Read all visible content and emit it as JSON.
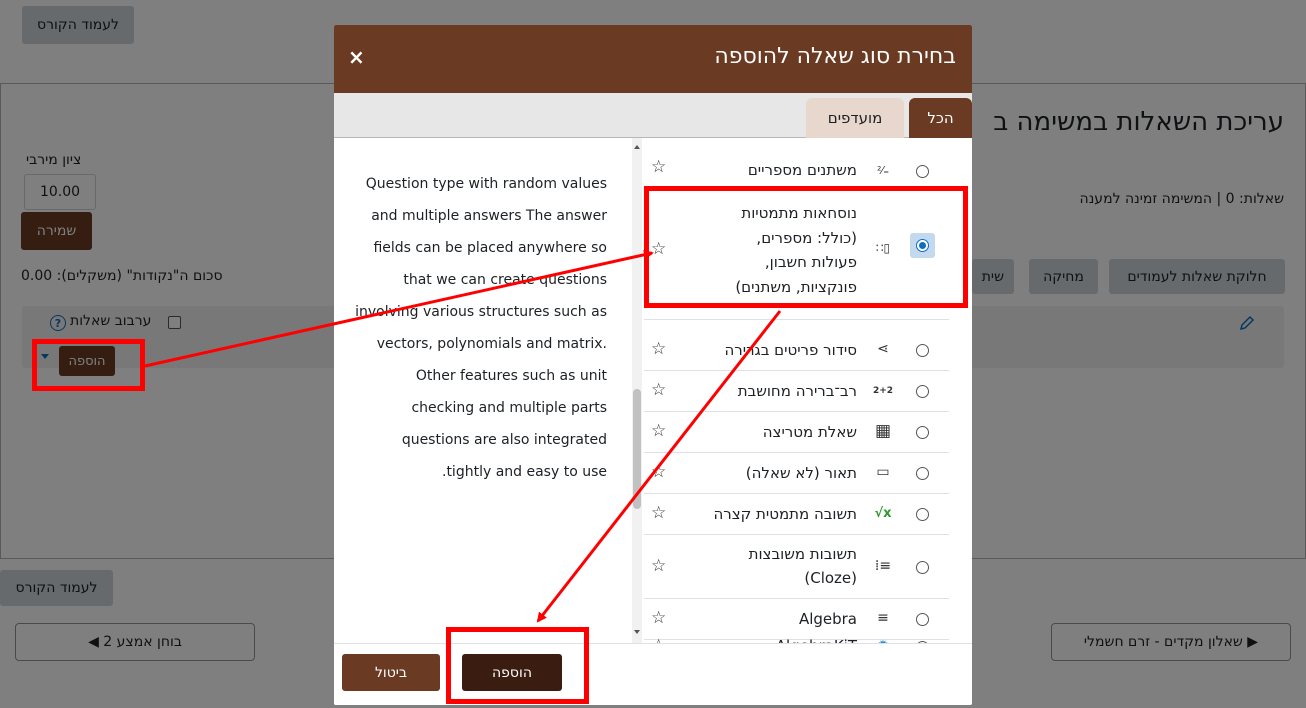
{
  "page": {
    "course_page_top": "לעמוד הקורס",
    "title": "עריכת השאלות במשימה ב",
    "max_grade_label": "ציון מירבי",
    "max_grade_value": "10.00",
    "save_button": "שמירה",
    "questions_status": "שאלות: 0 | המשימה זמינה למענה",
    "total_marks": "סכום ה\"נקודות\" (משקלים): 0.00",
    "repaginate_button": "חלוקת שאלות לעמודים",
    "delete_button": "מחיקה",
    "select_multiple_button": "שית",
    "shuffle_label": "ערבוב שאלות",
    "help_glyph": "?",
    "add_dropdown": "הוספה",
    "course_page_bottom": "לעמוד הקורס",
    "prev_activity": "◀ בוחן אמצע 2",
    "next_activity": "שאלון מקדים - זרם חשמלי ▶"
  },
  "modal": {
    "title": "בחירת סוג שאלה להוספה",
    "close": "×",
    "tabs": {
      "all": "הכל",
      "favourites": "מועדפים"
    },
    "description": "Question type with random values and multiple answers The answer fields can be placed anywhere so that we can create questions involving various structures such as vectors, polynomials and matrix. Other features such as unit checking and multiple parts questions are also integrated tightly and easy to use.",
    "question_types": [
      {
        "name": "משתנים מספריים",
        "icon": "numeric-variables-icon",
        "glyph": "²⁄₌"
      },
      {
        "name_lines": [
          "נוסחאות מתמטיות",
          "(כולל: מספרים,",
          "פעולות חשבון,",
          "פונקציות, משתנים)"
        ],
        "icon": "formulas-icon",
        "glyph": "∷▯",
        "selected": true
      },
      {
        "name": "סידור פריטים בגרירה",
        "icon": "ordering-icon",
        "glyph": "⋖"
      },
      {
        "name": "רב־ברירה מחושבת",
        "icon": "calculated-multichoice-icon",
        "glyph": "2+2"
      },
      {
        "name": "שאלת מטריצה",
        "icon": "matrix-icon",
        "glyph": "▦"
      },
      {
        "name": "תאור (לא שאלה)",
        "icon": "description-icon",
        "glyph": "▭"
      },
      {
        "name": "תשובה מתמטית קצרה",
        "icon": "stack-icon",
        "glyph": "√x"
      },
      {
        "name_lines": [
          "תשובות משובצות",
          "(Cloze)"
        ],
        "icon": "cloze-icon",
        "glyph": "⁞≡"
      },
      {
        "name": "Algebra",
        "icon": "algebra-icon",
        "glyph": "≡"
      },
      {
        "name": "AlgebraKiT",
        "icon": "algebrakit-icon",
        "glyph": "✹"
      }
    ],
    "favourite_star": "☆",
    "footer": {
      "add": "הוספה",
      "cancel": "ביטול"
    }
  },
  "colors": {
    "brand_brown": "#6b3a23",
    "annotation_red": "#ff0000"
  }
}
